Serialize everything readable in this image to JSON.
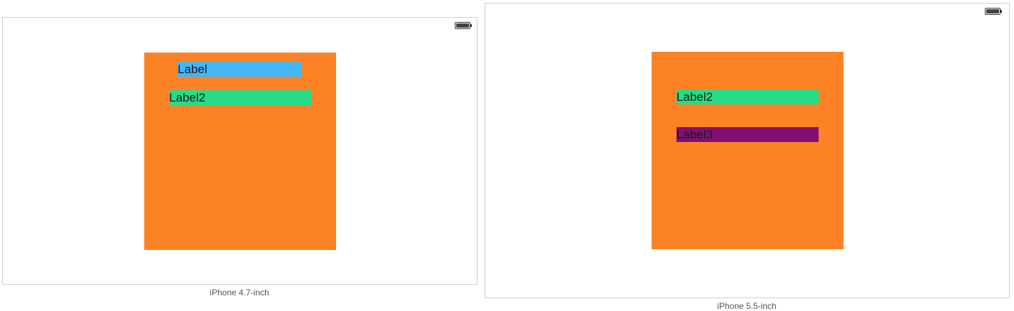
{
  "colors": {
    "orange": "#fd8226",
    "blue": "#45b5f5",
    "green": "#27dc86",
    "purple": "#820f74"
  },
  "devices": [
    {
      "caption": "iPhone 4.7-inch",
      "labels": [
        "Label",
        "Label2"
      ]
    },
    {
      "caption": "iPhone 5.5-inch",
      "labels": [
        "Label2",
        "Label3"
      ]
    }
  ]
}
